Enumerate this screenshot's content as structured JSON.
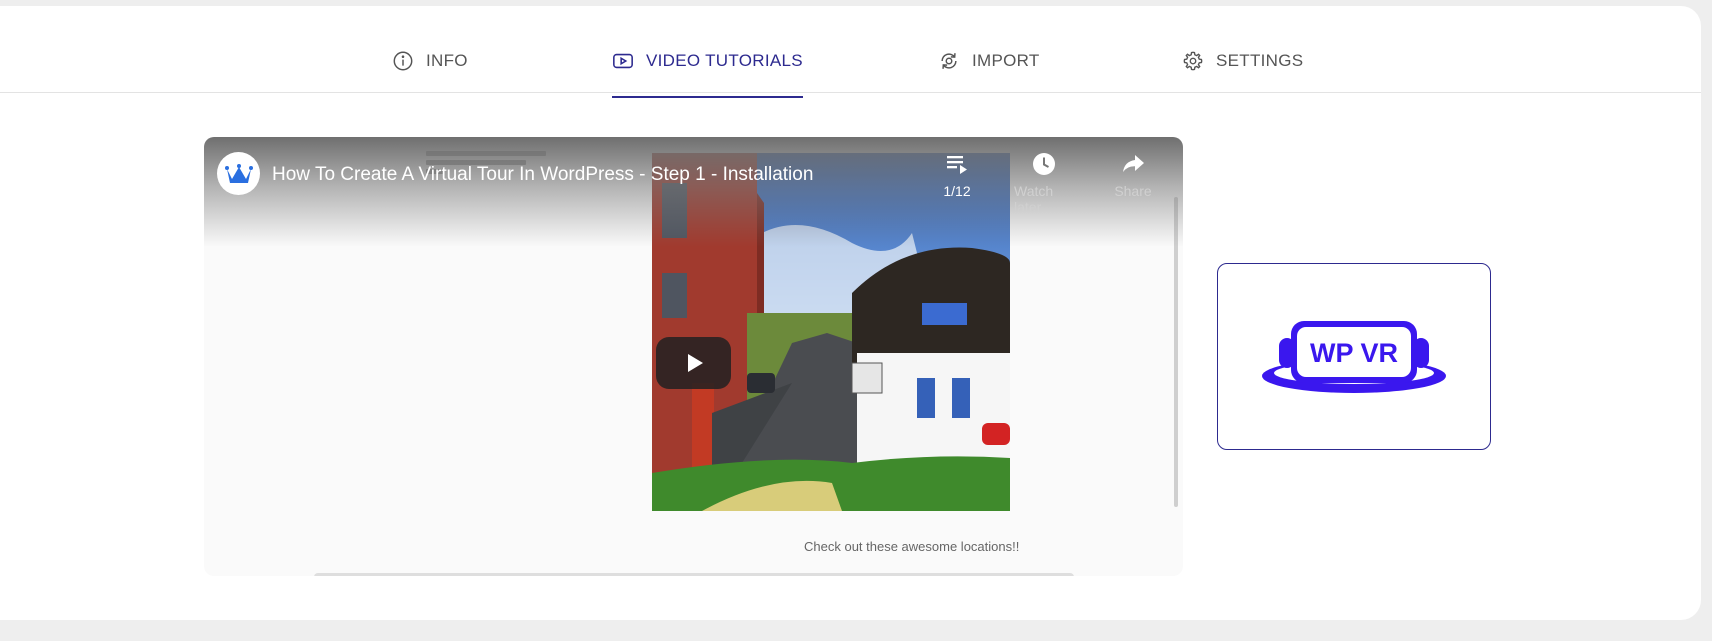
{
  "tabs": [
    {
      "label": "INFO",
      "icon": "info-icon",
      "active": false
    },
    {
      "label": "VIDEO TUTORIALS",
      "icon": "video-play-icon",
      "active": true
    },
    {
      "label": "IMPORT",
      "icon": "import-sync-icon",
      "active": false
    },
    {
      "label": "SETTINGS",
      "icon": "gear-icon",
      "active": false
    }
  ],
  "video": {
    "title": "How To Create A Virtual Tour In WordPress - Step 1 - Installation",
    "playlist_count": "1/12",
    "watch_later_label": "Watch later",
    "share_label": "Share",
    "caption": "Check out these awesome locations!!"
  },
  "logo": {
    "text": "WP VR",
    "color": "#3a17ee"
  },
  "colors": {
    "accent": "#2d2a8f",
    "page_bg": "#eeeeee",
    "card_bg": "#ffffff"
  }
}
